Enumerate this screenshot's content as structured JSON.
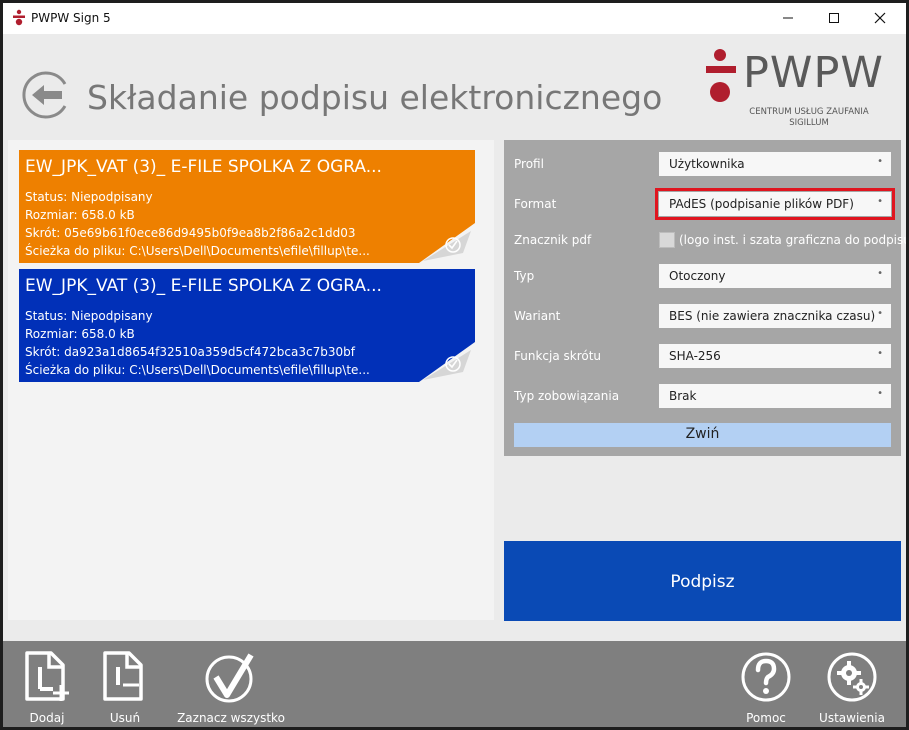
{
  "window": {
    "title": "PWPW Sign 5"
  },
  "header": {
    "title": "Składanie podpisu elektronicznego",
    "logo_text": "PWPW",
    "logo_sub1": "CENTRUM USŁUG ZAUFANIA",
    "logo_sub2": "SIGILLUM"
  },
  "files": [
    {
      "name": "EW_JPK_VAT (3)_ E-FILE SPOLKA Z OGRA...",
      "status": "Status: Niepodpisany",
      "size": "Rozmiar: 658.0 kB",
      "hash": "Skrót: 05e69b61f0ece86d9495b0f9ea8b2f86a2c1dd03",
      "path": "Ścieżka do pliku: C:\\Users\\Dell\\Documents\\efile\\fillup\\te...",
      "color": "#ee8000"
    },
    {
      "name": "EW_JPK_VAT (3)_ E-FILE SPOLKA Z OGRA...",
      "status": "Status: Niepodpisany",
      "size": "Rozmiar: 658.0 kB",
      "hash": "Skrót: da923a1d8654f32510a359d5cf472bca3c7b30bf",
      "path": "Ścieżka do pliku: C:\\Users\\Dell\\Documents\\efile\\fillup\\te...",
      "color": "#0130b8"
    }
  ],
  "settings": {
    "profile_label": "Profil",
    "profile_value": "Użytkownika",
    "format_label": "Format",
    "format_value": "PAdES (podpisanie plików PDF)",
    "pdf_marker_label": "Znacznik pdf",
    "pdf_marker_text": "(logo inst. i szata graficzna do podpisu)",
    "type_label": "Typ",
    "type_value": "Otoczony",
    "variant_label": "Wariant",
    "variant_value": "BES (nie zawiera znacznika czasu)",
    "hash_label": "Funkcja skrótu",
    "hash_value": "SHA-256",
    "commitment_label": "Typ zobowiązania",
    "commitment_value": "Brak",
    "collapse_label": "Zwiń",
    "dropdown_marker": "•"
  },
  "actions": {
    "sign_label": "Podpisz",
    "add_label": "Dodaj",
    "remove_label": "Usuń",
    "select_all_label": "Zaznacz wszystko",
    "help_label": "Pomoc",
    "settings_label": "Ustawienia"
  },
  "colors": {
    "brand_red": "#b01e2e",
    "sign_blue": "#0a4ab5",
    "highlight_red": "#e0151f"
  }
}
